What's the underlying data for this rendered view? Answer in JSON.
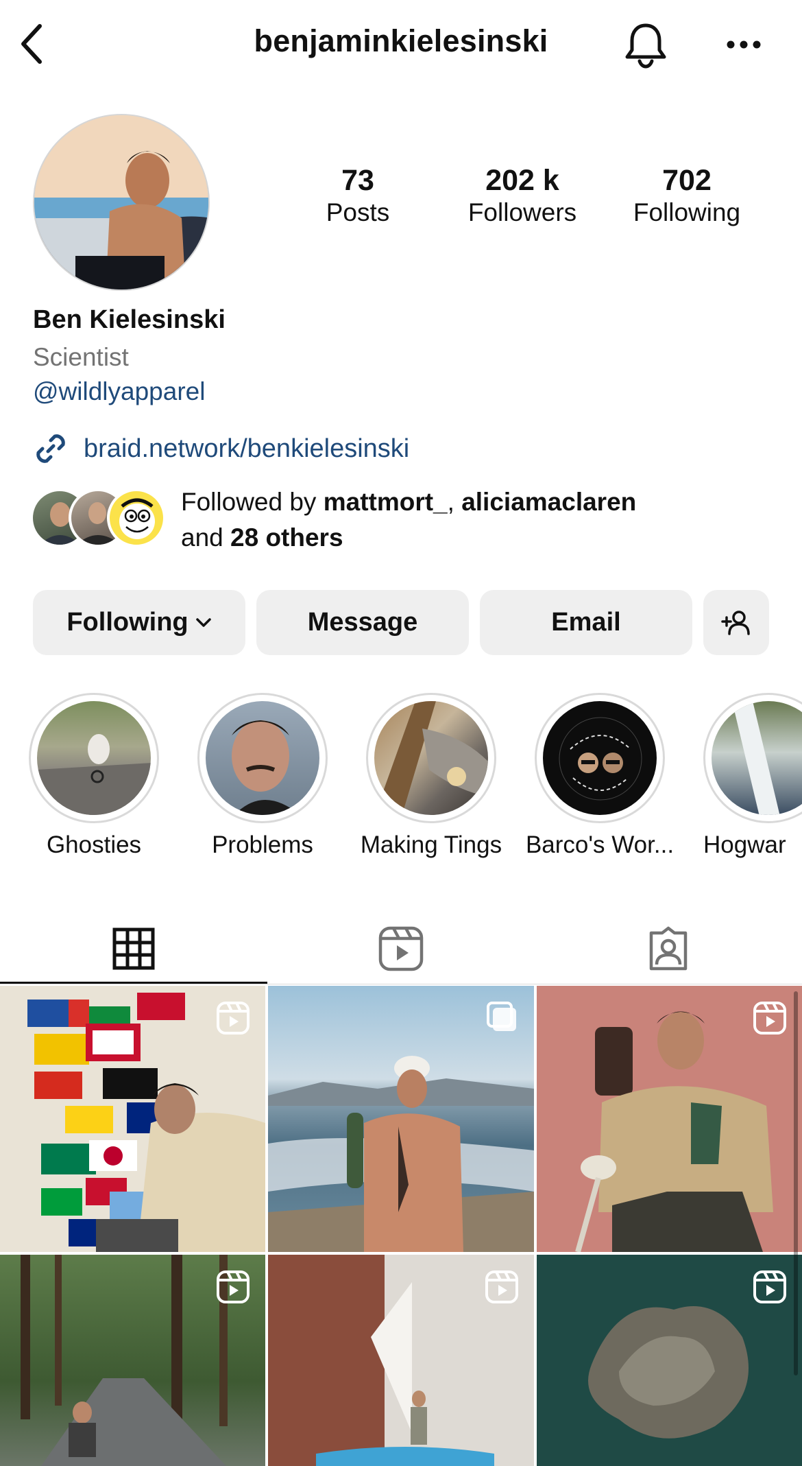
{
  "header": {
    "username": "benjaminkielesinski",
    "back_icon": "chevron-left-icon",
    "bell_icon": "bell-icon",
    "more_icon": "more-horizontal-icon"
  },
  "profile": {
    "stats": [
      {
        "value": "73",
        "label": "Posts"
      },
      {
        "value": "202 k",
        "label": "Followers"
      },
      {
        "value": "702",
        "label": "Following"
      }
    ],
    "name": "Ben Kielesinski",
    "category": "Scientist",
    "mention": "@wildlyapparel",
    "link": "braid.network/benkielesinski",
    "followed_by": {
      "prefix": "Followed by ",
      "user1": "mattmort_",
      "sep": ", ",
      "user2": "aliciamaclaren",
      "and": "and ",
      "others": "28 others"
    }
  },
  "actions": {
    "following": "Following",
    "message": "Message",
    "email": "Email"
  },
  "highlights": [
    {
      "label": "Ghosties"
    },
    {
      "label": "Problems"
    },
    {
      "label": "Making Tings"
    },
    {
      "label": "Barco's Wor..."
    },
    {
      "label": "Hogwar"
    }
  ],
  "tabs": [
    "grid-icon",
    "reels-icon",
    "tagged-icon"
  ],
  "colors": {
    "link": "#1f4a7a",
    "muted": "#737373",
    "button_bg": "#efefef"
  }
}
